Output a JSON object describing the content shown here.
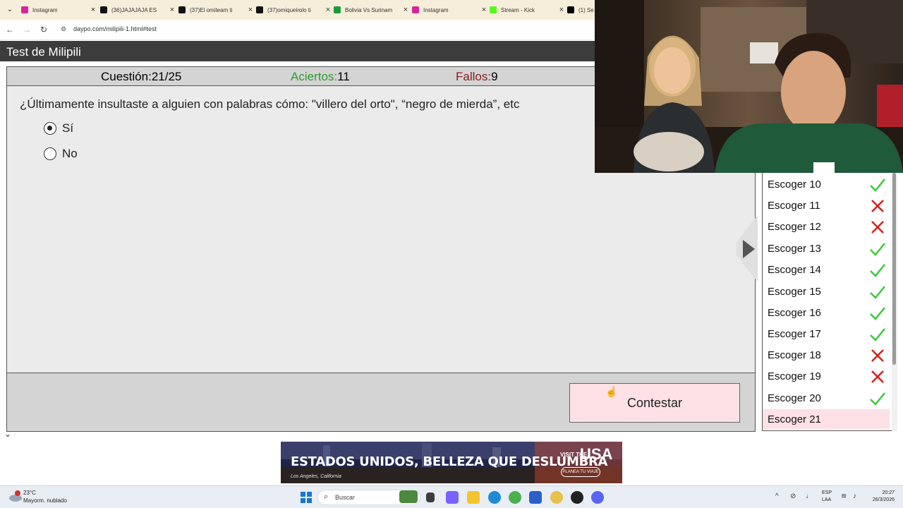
{
  "browser": {
    "tabs": [
      {
        "label": "Instagram",
        "favicon_color": "#d6249f"
      },
      {
        "label": "(36)JAJAJAJA ES",
        "favicon_color": "#111111"
      },
      {
        "label": "(37)El omiteam ti",
        "favicon_color": "#111111"
      },
      {
        "label": "(37)omiqueirolo ti",
        "favicon_color": "#111111"
      },
      {
        "label": "Bolivia Vs Surinam",
        "favicon_color": "#1a9b3b"
      },
      {
        "label": "Instagram",
        "favicon_color": "#d6249f"
      },
      {
        "label": "Stream - Kick",
        "favicon_color": "#53fc18"
      },
      {
        "label": "(1) Se",
        "favicon_color": "#000000"
      }
    ],
    "url": "daypo.com/milipili-1.html#test"
  },
  "page": {
    "title": "Test de Milipili",
    "stats": {
      "question_label": "Cuestión:",
      "question_value": "21/25",
      "correct_label": "Aciertos:",
      "correct_value": "11",
      "wrong_label": "Fallos:",
      "wrong_value": "9"
    },
    "question": "¿Últimamente insultaste a alguien con palabras cómo: \"villero del orto\", “negro de mierda”, etc",
    "options": [
      {
        "label": "Sí",
        "selected": true
      },
      {
        "label": "No",
        "selected": false
      }
    ],
    "submit_label": "Contestar",
    "answers": [
      {
        "label": "Escoger 10",
        "result": "correct"
      },
      {
        "label": "Escoger 11",
        "result": "wrong"
      },
      {
        "label": "Escoger 12",
        "result": "wrong"
      },
      {
        "label": "Escoger 13",
        "result": "correct"
      },
      {
        "label": "Escoger 14",
        "result": "correct"
      },
      {
        "label": "Escoger 15",
        "result": "correct"
      },
      {
        "label": "Escoger 16",
        "result": "correct"
      },
      {
        "label": "Escoger 17",
        "result": "correct"
      },
      {
        "label": "Escoger 18",
        "result": "wrong"
      },
      {
        "label": "Escoger 19",
        "result": "wrong"
      },
      {
        "label": "Escoger 20",
        "result": "correct"
      },
      {
        "label": "Escoger 21",
        "result": "current"
      }
    ],
    "colors": {
      "correct_text": "#2e9b2e",
      "wrong_text": "#8b1a1a",
      "check_mark": "#3cc93c",
      "cross_mark": "#d42020"
    }
  },
  "ad": {
    "headline": "ESTADOS UNIDOS, BELLEZA QUE DESLUMBRA",
    "location": "Los Angeles, California",
    "visit_small": "VISIT THE",
    "visit_big": "USA",
    "cta": "PLANEA TU VIAJE"
  },
  "taskbar": {
    "weather_temp": "23°C",
    "weather_desc": "Mayorm. nublado",
    "weather_badge": "1",
    "search_placeholder": "Buscar",
    "lang_primary": "ESP",
    "lang_secondary": "LAA",
    "time": "20:27",
    "date": "26/3/2026"
  }
}
